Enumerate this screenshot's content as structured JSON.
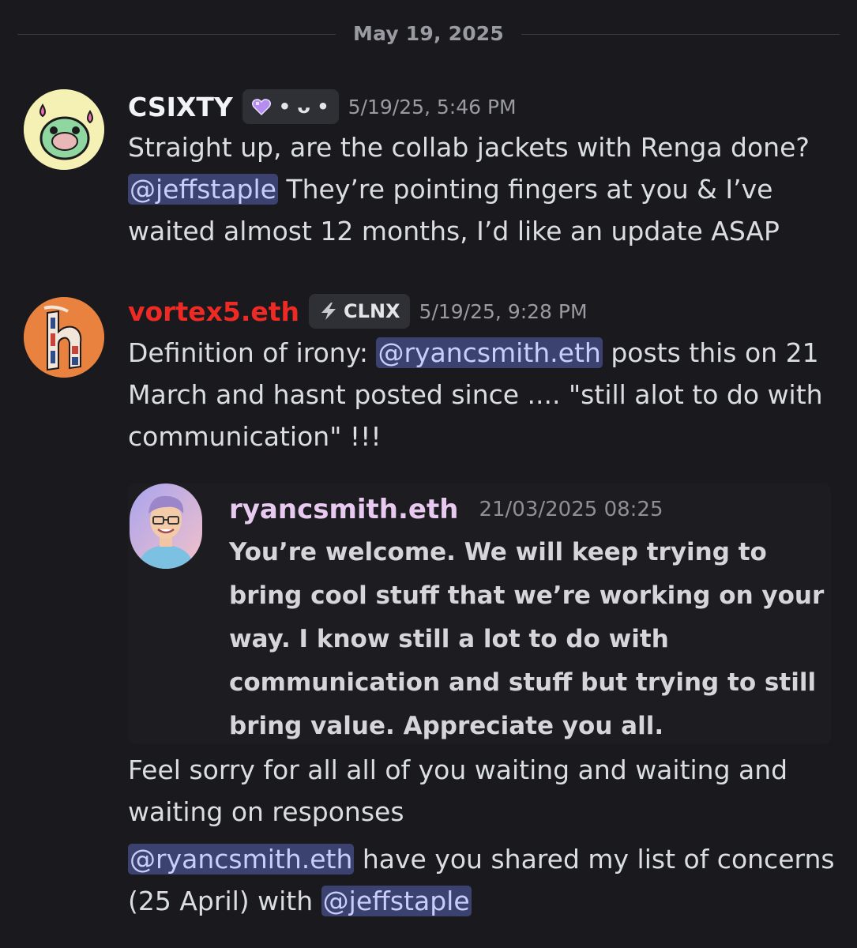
{
  "divider": {
    "date": "May 19, 2025"
  },
  "messages": [
    {
      "username": "CSIXTY",
      "tag": "• ᴗ •",
      "timestamp": "5/19/25, 5:46 PM",
      "line1": "Straight up, are the collab jackets with Renga done?",
      "mention": "@jeffstaple",
      "line2": " They’re pointing fingers at you & I’ve waited almost 12 months, I’d like an update ASAP"
    },
    {
      "username": "vortex5.eth",
      "tag": "CLNX",
      "timestamp": "5/19/25, 9:28 PM",
      "text_before": "Definition of irony: ",
      "mention": "@ryancsmith.eth",
      "text_after": " posts this on 21 March and hasnt posted since .... \"still alot to do with communication\" !!!",
      "quote": {
        "username": "ryancsmith.eth",
        "timestamp": "21/03/2025 08:25",
        "text": "You’re welcome. We will keep trying to bring cool stuff that we’re working on your way. I know still a lot to do with communication and stuff but trying to still bring value. Appreciate you all."
      },
      "followup1": "Feel sorry for all all of you waiting and waiting and waiting on responses",
      "followup2_mention1": "@ryancsmith.eth",
      "followup2_text": " have you shared my list of concerns (25 April) with ",
      "followup2_mention2": "@jeffstaple"
    }
  ],
  "colors": {
    "background": "#1a1a1e",
    "mention_bg": "#3c4270",
    "mention_text": "#c9cdfb",
    "vortex_name": "#ed2a24",
    "quote_name": "#e8c9ef"
  },
  "icons": {
    "csixty_tag": "heart-icon",
    "vortex_tag": "lightning-icon"
  }
}
